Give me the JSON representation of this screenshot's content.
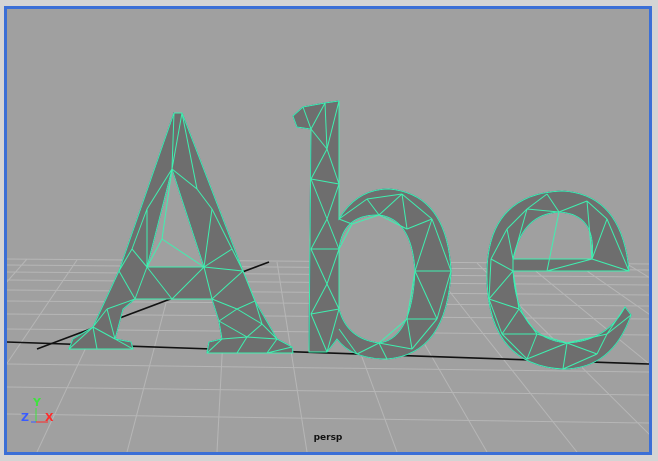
{
  "viewport": {
    "camera_name": "persp",
    "active_border_color": "#3b6fd6",
    "background_color": "#a0a0a0",
    "grid_color": "#b4b4b4",
    "wireframe_color": "#3ff0b0",
    "shaded_color": "#6e6e6e",
    "text_object": "Abe"
  },
  "axis_gizmo": {
    "y_label": "Y",
    "z_label": "Z",
    "x_label": "X",
    "y_color": "#3fe23f",
    "z_color": "#3a5cff",
    "x_color": "#ff2a2a"
  }
}
